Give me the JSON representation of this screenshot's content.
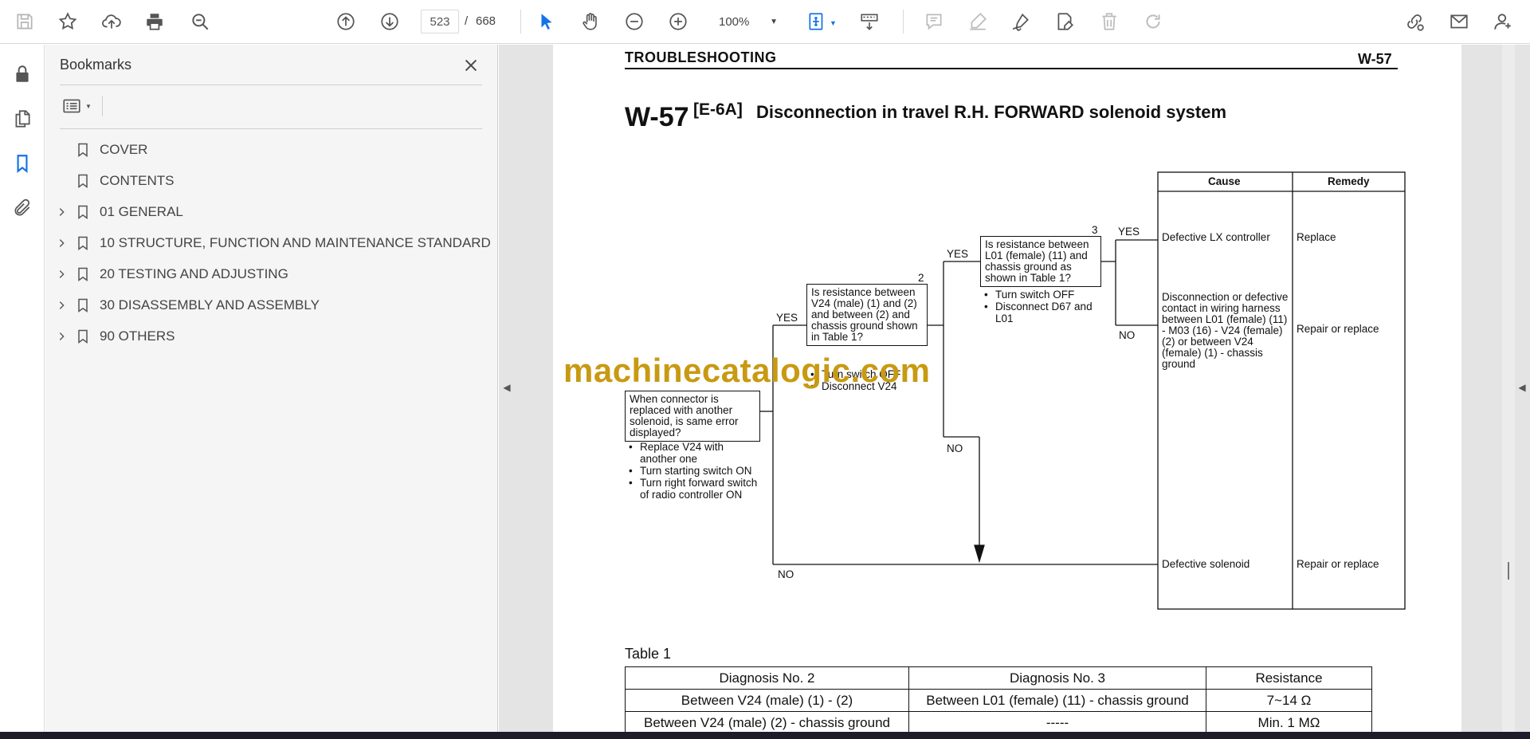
{
  "toolbar": {
    "current_page": "523",
    "total_pages": "668",
    "page_separator": "/",
    "zoom": "100%",
    "icons": [
      "save-icon",
      "bookmark-star-icon",
      "upload-icon",
      "print-icon",
      "zoom-search-icon",
      "page-up-icon",
      "page-down-icon",
      "zoom-out-icon",
      "zoom-in-icon",
      "select-cursor-icon",
      "hand-tool-icon",
      "fit-page-icon",
      "scroll-mode-icon",
      "comment-icon",
      "highlight-icon",
      "sign-icon",
      "edit-form-icon",
      "delete-icon",
      "redo-icon",
      "share-link-icon",
      "email-icon",
      "account-icon"
    ]
  },
  "bookmarks": {
    "title": "Bookmarks",
    "items": [
      {
        "label": "COVER",
        "expandable": false
      },
      {
        "label": "CONTENTS",
        "expandable": false
      },
      {
        "label": "01 GENERAL",
        "expandable": true
      },
      {
        "label": "10 STRUCTURE, FUNCTION AND MAINTENANCE STANDARD",
        "expandable": true
      },
      {
        "label": "20 TESTING AND ADJUSTING",
        "expandable": true
      },
      {
        "label": "30 DISASSEMBLY AND ASSEMBLY",
        "expandable": true
      },
      {
        "label": "90 OTHERS",
        "expandable": true
      }
    ]
  },
  "document": {
    "header_left": "TROUBLESHOOTING",
    "header_right": "W-57",
    "title_code": "W-57",
    "title_sub": "[E-6A]",
    "title_text": "Disconnection in travel R.H. FORWARD solenoid system",
    "watermark": "machinecatalogic.com",
    "flow": {
      "cause_header": "Cause",
      "remedy_header": "Remedy",
      "q1": {
        "number": "",
        "text": "When connector is replaced with another solenoid, is same error displayed?",
        "bullets": [
          "Replace V24 with another one",
          "Turn starting switch ON",
          "Turn right forward switch of radio controller ON"
        ]
      },
      "q2": {
        "number": "2",
        "text": "Is resistance between V24 (male) (1) and (2) and between (2) and chassis ground shown in Table 1?",
        "bullets": [
          "Turn switch OFF",
          "Disconnect V24"
        ]
      },
      "q3": {
        "number": "3",
        "text": "Is resistance between L01 (female) (11) and chassis ground as shown in Table 1?",
        "bullets": [
          "Turn switch OFF",
          "Disconnect D67 and L01"
        ]
      },
      "yes": "YES",
      "no": "NO",
      "outcomes": [
        {
          "cause": "Defective LX controller",
          "remedy": "Replace"
        },
        {
          "cause": "Disconnection or defective contact in wiring harness between L01 (female) (11) - M03 (16) - V24 (female) (2) or between V24 (female) (1) - chassis ground",
          "remedy": "Repair or replace"
        },
        {
          "cause": "Defective solenoid",
          "remedy": "Repair or replace"
        }
      ]
    },
    "table1": {
      "label": "Table 1",
      "headers": [
        "Diagnosis No. 2",
        "Diagnosis No. 3",
        "Resistance"
      ],
      "rows": [
        [
          "Between V24 (male) (1) - (2)",
          "Between L01 (female) (11) - chassis ground",
          "7~14 Ω"
        ],
        [
          "Between V24 (male) (2) - chassis ground",
          "-----",
          "Min. 1 MΩ"
        ]
      ]
    }
  }
}
